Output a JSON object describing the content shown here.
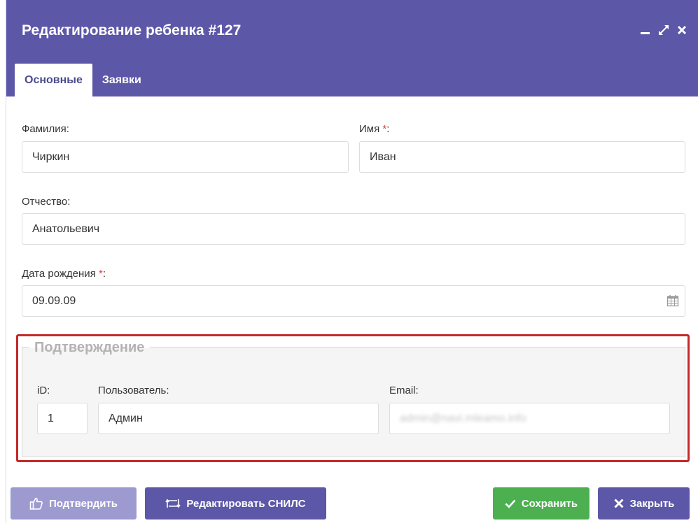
{
  "dialog": {
    "title": "Редактирование ребенка #127",
    "window_controls": [
      "minimize-icon",
      "maximize-icon",
      "close-icon"
    ]
  },
  "tabs": [
    {
      "label": "Основные",
      "active": true
    },
    {
      "label": "Заявки",
      "active": false
    }
  ],
  "form": {
    "last_name": {
      "label": "Фамилия:",
      "value": "Чиркин"
    },
    "first_name": {
      "label": "Имя",
      "required_mark": "*",
      "suffix": ":",
      "value": "Иван"
    },
    "patronymic": {
      "label": "Отчество:",
      "value": "Анатольевич"
    },
    "birth_date": {
      "label": "Дата рождения",
      "required_mark": "*",
      "suffix": ":",
      "value": "09.09.09",
      "icon": "calendar-icon"
    }
  },
  "confirmation": {
    "legend": "Подтверждение",
    "id": {
      "label": "iD:",
      "value": "1"
    },
    "user": {
      "label": "Пользователь:",
      "value": "Админ"
    },
    "email": {
      "label": "Email:",
      "value": "admin@navi.mleamo.info"
    }
  },
  "footer": {
    "confirm_label": "Подтвердить",
    "edit_snils_label": "Редактировать СНИЛС",
    "save_label": "Сохранить",
    "close_label": "Закрыть"
  },
  "colors": {
    "header": "#5d57a8",
    "confirm_disabled": "#9d9ad0",
    "primary": "#5d57a8",
    "save": "#4caf50",
    "required": "#e03a3a",
    "highlight_border": "#c62828"
  }
}
